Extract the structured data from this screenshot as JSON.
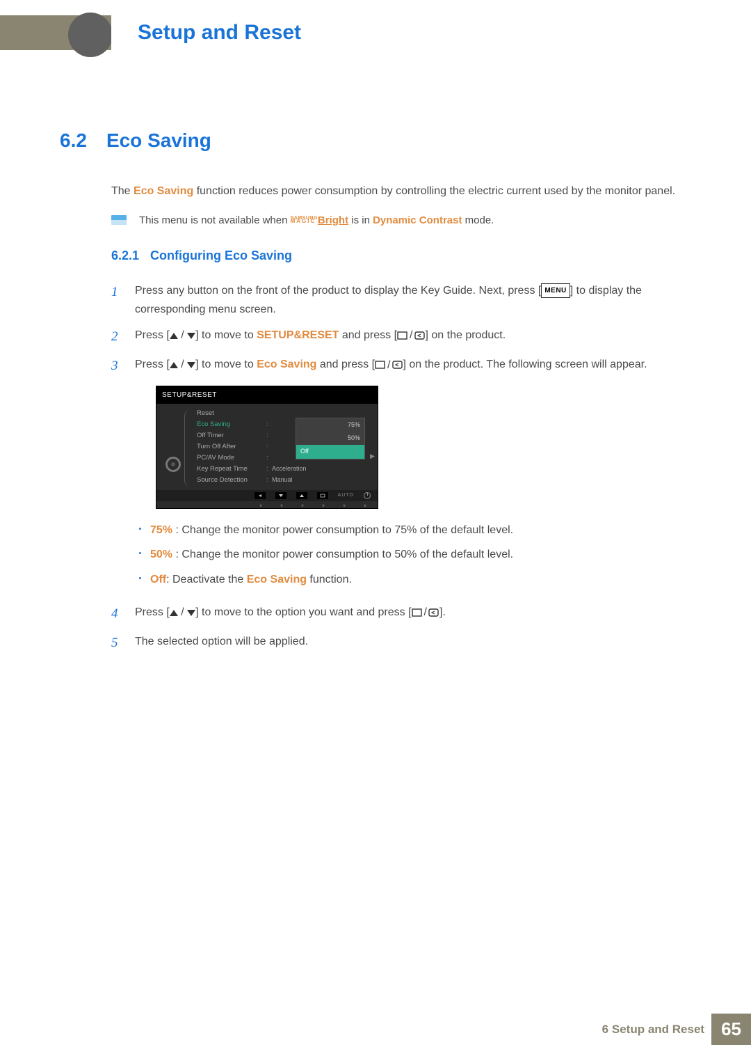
{
  "header": {
    "chapter_title": "Setup and Reset"
  },
  "section": {
    "number": "6.2",
    "title": "Eco Saving"
  },
  "intro": {
    "prefix": "The ",
    "feature": "Eco Saving",
    "suffix": " function reduces power consumption by controlling the electric current used by the monitor panel."
  },
  "note": {
    "pre": "This menu is not available when ",
    "magic_top": "SAMSUNG",
    "magic_bottom": "MAGIC",
    "bright": "Bright",
    "mid": " is in ",
    "dc": "Dynamic Contrast",
    "post": " mode."
  },
  "subsection": {
    "number": "6.2.1",
    "title": "Configuring Eco Saving"
  },
  "steps": {
    "s1": {
      "num": "1",
      "a": "Press any button on the front of the product to display the Key Guide. Next, press [",
      "menu": "MENU",
      "b": "] to display the corresponding menu screen."
    },
    "s2": {
      "num": "2",
      "a": "Press [",
      "b": "] to move to ",
      "ssr": "SETUP&RESET",
      "c": " and press [",
      "d": "] on the product."
    },
    "s3": {
      "num": "3",
      "a": "Press [",
      "b": "] to move to ",
      "eco": "Eco Saving",
      "c": " and press [",
      "d": "] on the product. The following screen will appear."
    },
    "s4": {
      "num": "4",
      "a": "Press [",
      "b": "] to move to the option you want and press [",
      "c": "]."
    },
    "s5": {
      "num": "5",
      "text": "The selected option will be applied."
    }
  },
  "osd": {
    "title": "SETUP&RESET",
    "items": {
      "reset": "Reset",
      "eco": "Eco Saving",
      "off_timer": "Off Timer",
      "turn_off": "Turn Off After",
      "pcav": "PC/AV Mode",
      "krt": "Key Repeat Time",
      "krt_val": "Acceleration",
      "src": "Source Detection",
      "src_val": "Manual"
    },
    "popup": {
      "p75": "75%",
      "p50": "50%",
      "off": "Off"
    },
    "auto": "AUTO"
  },
  "options": {
    "o1": {
      "pct": "75%",
      "text": " : Change the monitor power consumption to 75% of the default level."
    },
    "o2": {
      "pct": "50%",
      "text": " : Change the monitor power consumption to 50% of the default level."
    },
    "o3": {
      "off": "Off",
      "mid": ": Deactivate the ",
      "eco": "Eco Saving",
      "post": " function."
    }
  },
  "footer": {
    "chapter": "6",
    "label": "Setup and Reset",
    "page": "65"
  }
}
